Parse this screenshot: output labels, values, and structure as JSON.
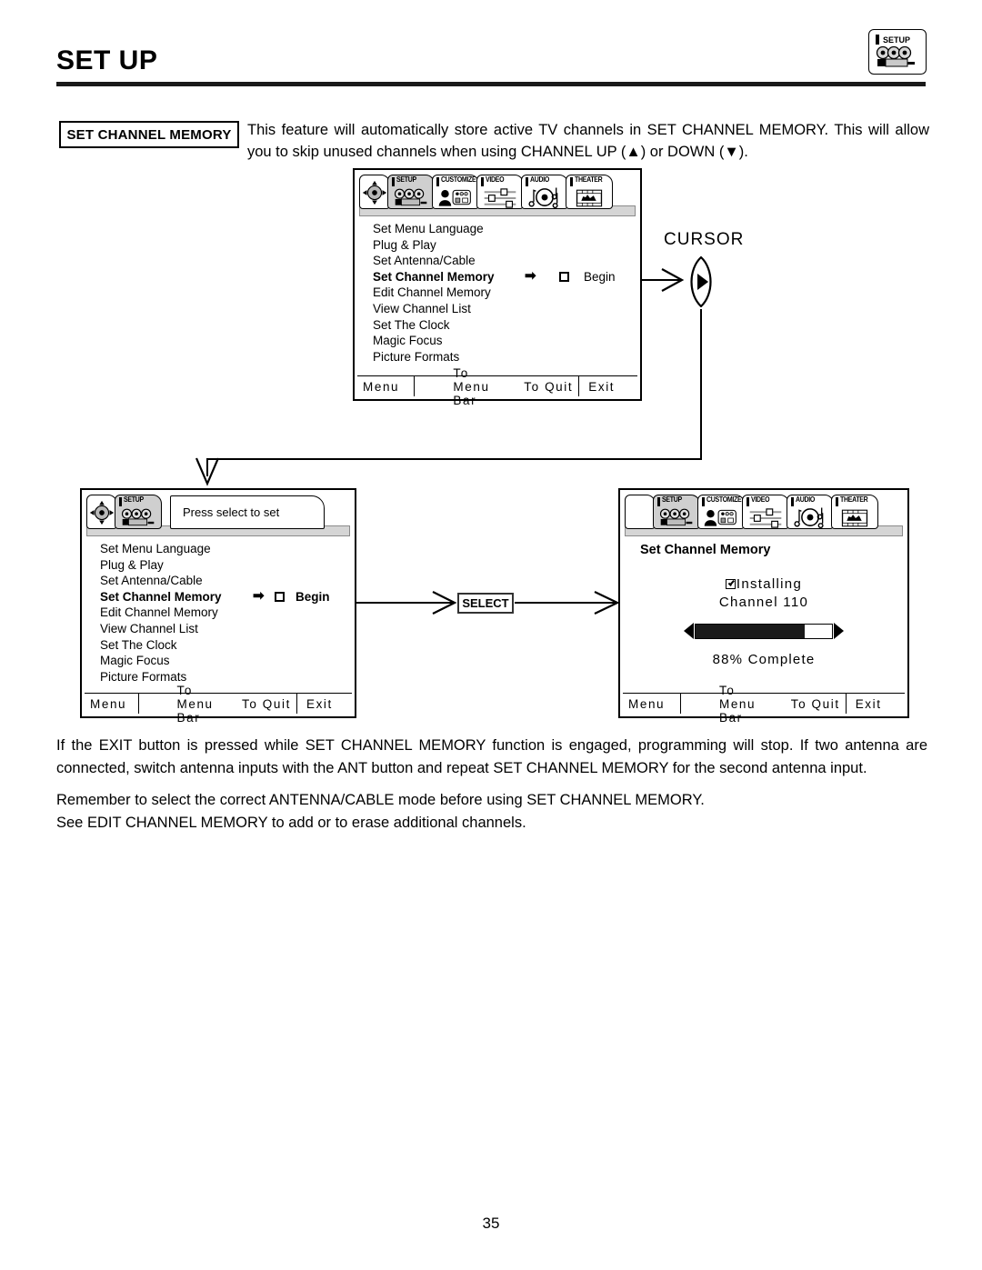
{
  "document": {
    "page_title": "SET UP",
    "page_number": "35",
    "header_icon": "setup-icon"
  },
  "callout": {
    "label": "SET CHANNEL MEMORY",
    "intro": "This feature will automatically store active TV channels in SET CHANNEL MEMORY.  This will allow you to skip unused channels when using CHANNEL UP (▲) or DOWN (▼)."
  },
  "menu_tabs": [
    {
      "label": "",
      "icon": "dpad-cursor-icon",
      "selected": false
    },
    {
      "label": "SETUP",
      "icon": "setup-camera-icon",
      "selected": true
    },
    {
      "label": "CUSTOMIZE",
      "icon": "customize-person-icon",
      "selected": false
    },
    {
      "label": "VIDEO",
      "icon": "video-sliders-icon",
      "selected": false
    },
    {
      "label": "AUDIO",
      "icon": "audio-speaker-icon",
      "selected": false
    },
    {
      "label": "THEATER",
      "icon": "theater-film-icon",
      "selected": false
    }
  ],
  "setup_menu": {
    "items": [
      "Set Menu Language",
      "Plug & Play",
      "Set Antenna/Cable",
      "Set Channel Memory",
      "Edit Channel Memory",
      "View Channel List",
      "Set The Clock",
      "Magic Focus",
      "Picture Formats"
    ],
    "active_index": 3,
    "begin_label": "Begin",
    "arrow_glyph": "➡"
  },
  "footer": {
    "menu": "Menu",
    "to_menu_bar": "To Menu Bar",
    "to_quit": "To Quit",
    "exit": "Exit"
  },
  "screen_top": {
    "name": "setup-menu-screen"
  },
  "screen_bottom_left": {
    "hint": "Press select to set"
  },
  "screen_bottom_right": {
    "title": "Set Channel Memory",
    "status_line_1": "Installing",
    "status_line_2": "Channel 110",
    "percent_text": "88% Complete",
    "progress_percent": 88,
    "progress_fill_ratio": 80
  },
  "annotations": {
    "cursor_label": "CURSOR",
    "select_label": "SELECT"
  },
  "body_paragraphs": [
    "If the EXIT button is pressed while SET CHANNEL MEMORY function is engaged, programming will stop.  If two antenna are connected, switch antenna inputs with the ANT button and repeat SET CHANNEL MEMORY for the second antenna input.",
    "Remember to select the correct ANTENNA/CABLE mode before using SET CHANNEL MEMORY.\nSee EDIT CHANNEL MEMORY to add or to erase additional channels."
  ],
  "colors": {
    "ink": "#000000",
    "paper": "#ffffff",
    "tab_selected": "#cfcfcf",
    "strip": "#d5d5d5"
  }
}
